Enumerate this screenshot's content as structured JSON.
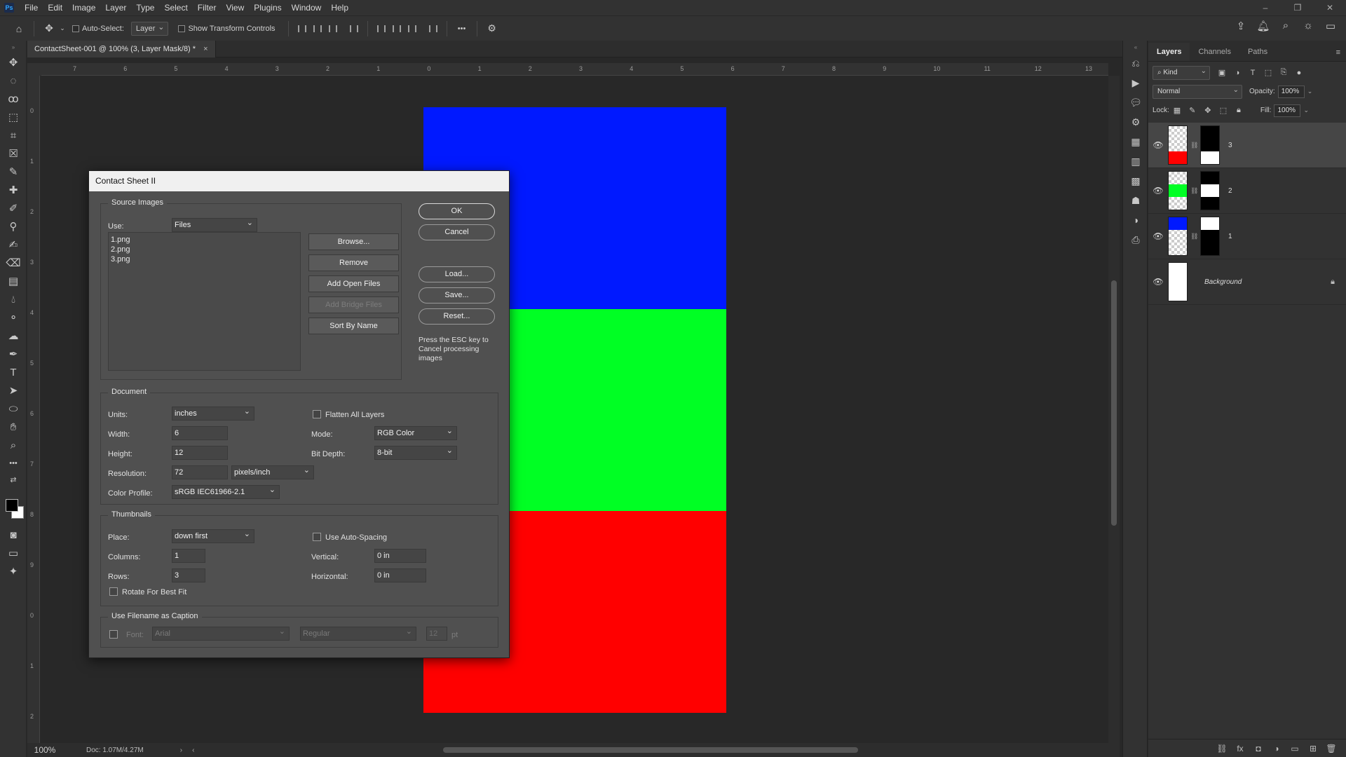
{
  "app": {
    "logo": "Ps"
  },
  "menu": [
    "File",
    "Edit",
    "Image",
    "Layer",
    "Type",
    "Select",
    "Filter",
    "View",
    "Plugins",
    "Window",
    "Help"
  ],
  "window_controls": {
    "minimize": "–",
    "restore": "❐",
    "close": "✕"
  },
  "options_bar": {
    "auto_select_label": "Auto-Select:",
    "auto_select_target": "Layer",
    "show_transform_label": "Show Transform Controls",
    "more": "•••"
  },
  "document": {
    "tab_title": "ContactSheet-001 @ 100% (3, Layer Mask/8) *",
    "close": "×",
    "zoom": "100%",
    "doc_info": "Doc: 1.07M/4.27M",
    "ruler_top_labels": [
      "7",
      "6",
      "5",
      "4",
      "3",
      "2",
      "1",
      "0",
      "1",
      "2",
      "3",
      "4",
      "5",
      "6",
      "7",
      "8",
      "9",
      "10",
      "11",
      "12",
      "13"
    ],
    "ruler_left_labels": [
      "0",
      "1",
      "2",
      "3",
      "4",
      "5",
      "6",
      "7",
      "8",
      "9",
      "0",
      "1",
      "2"
    ],
    "colors": {
      "top": "#0019ff",
      "middle": "#00ff24",
      "bottom": "#ff0000"
    }
  },
  "layers_panel": {
    "tabs": [
      "Layers",
      "Channels",
      "Paths"
    ],
    "filter_kind": "Kind",
    "blend_mode": "Normal",
    "opacity_label": "Opacity:",
    "opacity_value": "100%",
    "lock_label": "Lock:",
    "fill_label": "Fill:",
    "fill_value": "100%",
    "layers": [
      {
        "name": "3",
        "color": "#ff0000",
        "mask": "top-black"
      },
      {
        "name": "2",
        "color": "#00ff24",
        "mask": "middle-white"
      },
      {
        "name": "1",
        "color": "#0019ff",
        "mask": "top-white"
      },
      {
        "name": "Background",
        "locked": true
      }
    ]
  },
  "dialog": {
    "title": "Contact Sheet II",
    "source_images": {
      "title": "Source Images",
      "use_label": "Use:",
      "use_value": "Files",
      "files": [
        "1.png",
        "2.png",
        "3.png"
      ],
      "browse": "Browse...",
      "remove": "Remove",
      "add_open": "Add Open Files",
      "add_bridge": "Add Bridge Files",
      "sort": "Sort By Name"
    },
    "buttons": {
      "ok": "OK",
      "cancel": "Cancel",
      "load": "Load...",
      "save": "Save...",
      "reset": "Reset..."
    },
    "note": "Press the ESC key to Cancel processing images",
    "document": {
      "title": "Document",
      "units_label": "Units:",
      "units_value": "inches",
      "width_label": "Width:",
      "width_value": "6",
      "height_label": "Height:",
      "height_value": "12",
      "resolution_label": "Resolution:",
      "resolution_value": "72",
      "resolution_unit": "pixels/inch",
      "profile_label": "Color Profile:",
      "profile_value": "sRGB IEC61966-2.1",
      "flatten_label": "Flatten All Layers",
      "mode_label": "Mode:",
      "mode_value": "RGB Color",
      "depth_label": "Bit Depth:",
      "depth_value": "8-bit"
    },
    "thumbnails": {
      "title": "Thumbnails",
      "place_label": "Place:",
      "place_value": "down first",
      "columns_label": "Columns:",
      "columns_value": "1",
      "rows_label": "Rows:",
      "rows_value": "3",
      "rotate_label": "Rotate For Best Fit",
      "autospacing_label": "Use Auto-Spacing",
      "vertical_label": "Vertical:",
      "vertical_value": "0 in",
      "horizontal_label": "Horizontal:",
      "horizontal_value": "0 in"
    },
    "caption": {
      "title": "Use Filename as Caption",
      "font_label": "Font:",
      "font_value": "Arial",
      "style_value": "Regular",
      "size_value": "12",
      "size_unit": "pt"
    }
  }
}
